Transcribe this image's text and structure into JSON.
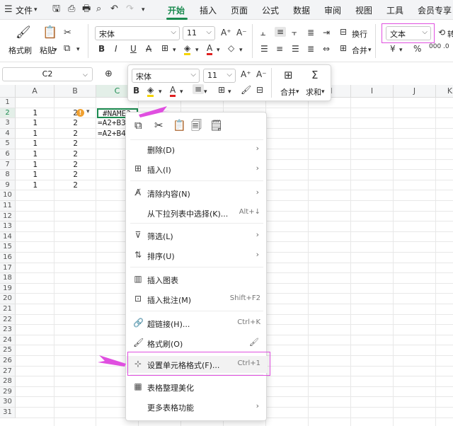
{
  "tabbar": {
    "file_label": "文件",
    "tabs": [
      "开始",
      "插入",
      "页面",
      "公式",
      "数据",
      "审阅",
      "视图",
      "工具",
      "会员专享"
    ]
  },
  "ribbon": {
    "format_painter": "格式刷",
    "paste": "粘贴",
    "font_name": "宋体",
    "font_size": "11",
    "wrap_text": "换行",
    "merge": "合并",
    "number_format": "文本",
    "currency_symbol": "¥",
    "percent_symbol": "%"
  },
  "formula_bar": {
    "name_box": "C2"
  },
  "grid": {
    "columns": [
      "A",
      "B",
      "C",
      "D",
      "E",
      "F",
      "G",
      "H",
      "I",
      "J",
      "K"
    ],
    "rows": [
      "1",
      "2",
      "3",
      "4",
      "5",
      "6",
      "7",
      "8",
      "9",
      "10",
      "11",
      "12",
      "13",
      "14",
      "15",
      "16",
      "17",
      "18",
      "19",
      "20",
      "21",
      "22",
      "23",
      "24",
      "25",
      "26",
      "27",
      "28",
      "29",
      "30",
      "31"
    ],
    "colA": [
      "1",
      "1",
      "1",
      "1",
      "1",
      "1",
      "1",
      "1"
    ],
    "colB": [
      "2",
      "2",
      "2",
      "2",
      "2",
      "2",
      "2",
      "2"
    ],
    "c2": "#NAME?",
    "c3": "=A2+B3",
    "c4": "=A2+B4"
  },
  "mini_toolbar": {
    "font_name": "宋体",
    "font_size": "11",
    "merge_label": "合并",
    "sum_label": "求和"
  },
  "context_menu": {
    "items": [
      {
        "label": "删除(D)",
        "shortcut": ""
      },
      {
        "label": "插入(I)",
        "shortcut": ""
      },
      {
        "label": "清除内容(N)",
        "shortcut": ""
      },
      {
        "label": "从下拉列表中选择(K)...",
        "shortcut": "Alt+↓"
      },
      {
        "label": "筛选(L)",
        "shortcut": ""
      },
      {
        "label": "排序(U)",
        "shortcut": ""
      },
      {
        "label": "插入图表",
        "shortcut": ""
      },
      {
        "label": "插入批注(M)",
        "shortcut": "Shift+F2"
      },
      {
        "label": "超链接(H)...",
        "shortcut": "Ctrl+K"
      },
      {
        "label": "格式刷(O)",
        "shortcut": ""
      },
      {
        "label": "设置单元格格式(F)...",
        "shortcut": "Ctrl+1"
      },
      {
        "label": "表格整理美化",
        "shortcut": ""
      },
      {
        "label": "更多表格功能",
        "shortcut": ""
      }
    ]
  },
  "colors": {
    "accent": "#1a8a4f",
    "highlight": "#e04fe0"
  }
}
